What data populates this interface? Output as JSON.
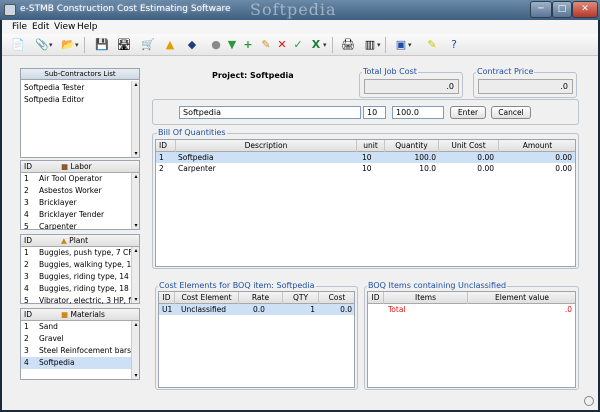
{
  "window": {
    "title": "e-STMB Construction Cost Estimating Software",
    "watermark": "Softpedia"
  },
  "menu": [
    "File",
    "Edit",
    "View",
    "Help"
  ],
  "toolbar": {
    "icons": [
      "new-icon",
      "attach-icon",
      "open-icon",
      "save-icon",
      "wheelbarrow-icon",
      "cart-icon",
      "hardhat-icon",
      "paint-icon",
      "circle-icon",
      "download-icon",
      "add-icon",
      "pencil-icon",
      "delete-icon",
      "check-icon",
      "excel-icon",
      "print-icon",
      "chart-icon",
      "window-icon",
      "notes-icon",
      "help-icon"
    ]
  },
  "subcontractors": {
    "title": "Sub-Contractors List",
    "items": [
      "Softpedia Tester",
      "Softpedia Editor"
    ]
  },
  "labor": {
    "header": "Labor",
    "id_header": "ID",
    "rows": [
      {
        "id": "1",
        "name": "Air Tool Operator"
      },
      {
        "id": "2",
        "name": "Asbestos Worker"
      },
      {
        "id": "3",
        "name": "Bricklayer"
      },
      {
        "id": "4",
        "name": "Bricklayer Tender"
      },
      {
        "id": "5",
        "name": "Carpenter"
      }
    ]
  },
  "plant": {
    "header": "Plant",
    "id_header": "ID",
    "rows": [
      {
        "id": "1",
        "name": "Buggies, push type, 7 CF"
      },
      {
        "id": "2",
        "name": "Buggies, walking type, 12 CF"
      },
      {
        "id": "3",
        "name": "Buggies, riding type, 14 CF"
      },
      {
        "id": "4",
        "name": "Buggies, riding type, 18 CF"
      },
      {
        "id": "5",
        "name": "Vibrator, electric, 3 HP, flexibl"
      }
    ]
  },
  "materials": {
    "header": "Materials",
    "id_header": "ID",
    "rows": [
      {
        "id": "1",
        "name": "Sand"
      },
      {
        "id": "2",
        "name": "Gravel"
      },
      {
        "id": "3",
        "name": "Steel Reinfocement bars"
      },
      {
        "id": "4",
        "name": "Softpedia",
        "selected": true
      }
    ]
  },
  "project": {
    "label": "Project: Softpedia"
  },
  "total_job_cost": {
    "label": "Total Job Cost",
    "value": ".0"
  },
  "contract_price": {
    "label": "Contract Price",
    "value": ".0"
  },
  "entry": {
    "description": "Softpedia",
    "unit": "10",
    "quantity": "100.0",
    "enter_label": "Enter",
    "cancel_label": "Cancel"
  },
  "boq": {
    "title": "Bill Of Quantities",
    "columns": [
      "ID",
      "Description",
      "unit",
      "Quantity",
      "Unit Cost",
      "Amount"
    ],
    "rows": [
      {
        "id": "1",
        "description": "Softpedia",
        "unit": "10",
        "quantity": "100.0",
        "unit_cost": "0.00",
        "amount": "0.00",
        "selected": true
      },
      {
        "id": "2",
        "description": "Carpenter",
        "unit": "10",
        "quantity": "10.0",
        "unit_cost": "0.00",
        "amount": "0.00"
      }
    ]
  },
  "cost_elements": {
    "title": "Cost Elements for BOQ item: Softpedia",
    "columns": [
      "ID",
      "Cost Element",
      "Rate",
      "QTY",
      "Cost"
    ],
    "rows": [
      {
        "id": "U1",
        "element": "Unclassified",
        "rate": "0.0",
        "qty": "1",
        "cost": "0.0"
      }
    ]
  },
  "boq_items": {
    "title": "BOQ Items containing  Unclassified",
    "columns": [
      "ID",
      "Items",
      "Element value"
    ],
    "total_label": "Total",
    "total_value": ".0"
  },
  "colors": {
    "accent": "#1f4fa3",
    "selection": "#cde0f5",
    "total": "#dd1111"
  }
}
